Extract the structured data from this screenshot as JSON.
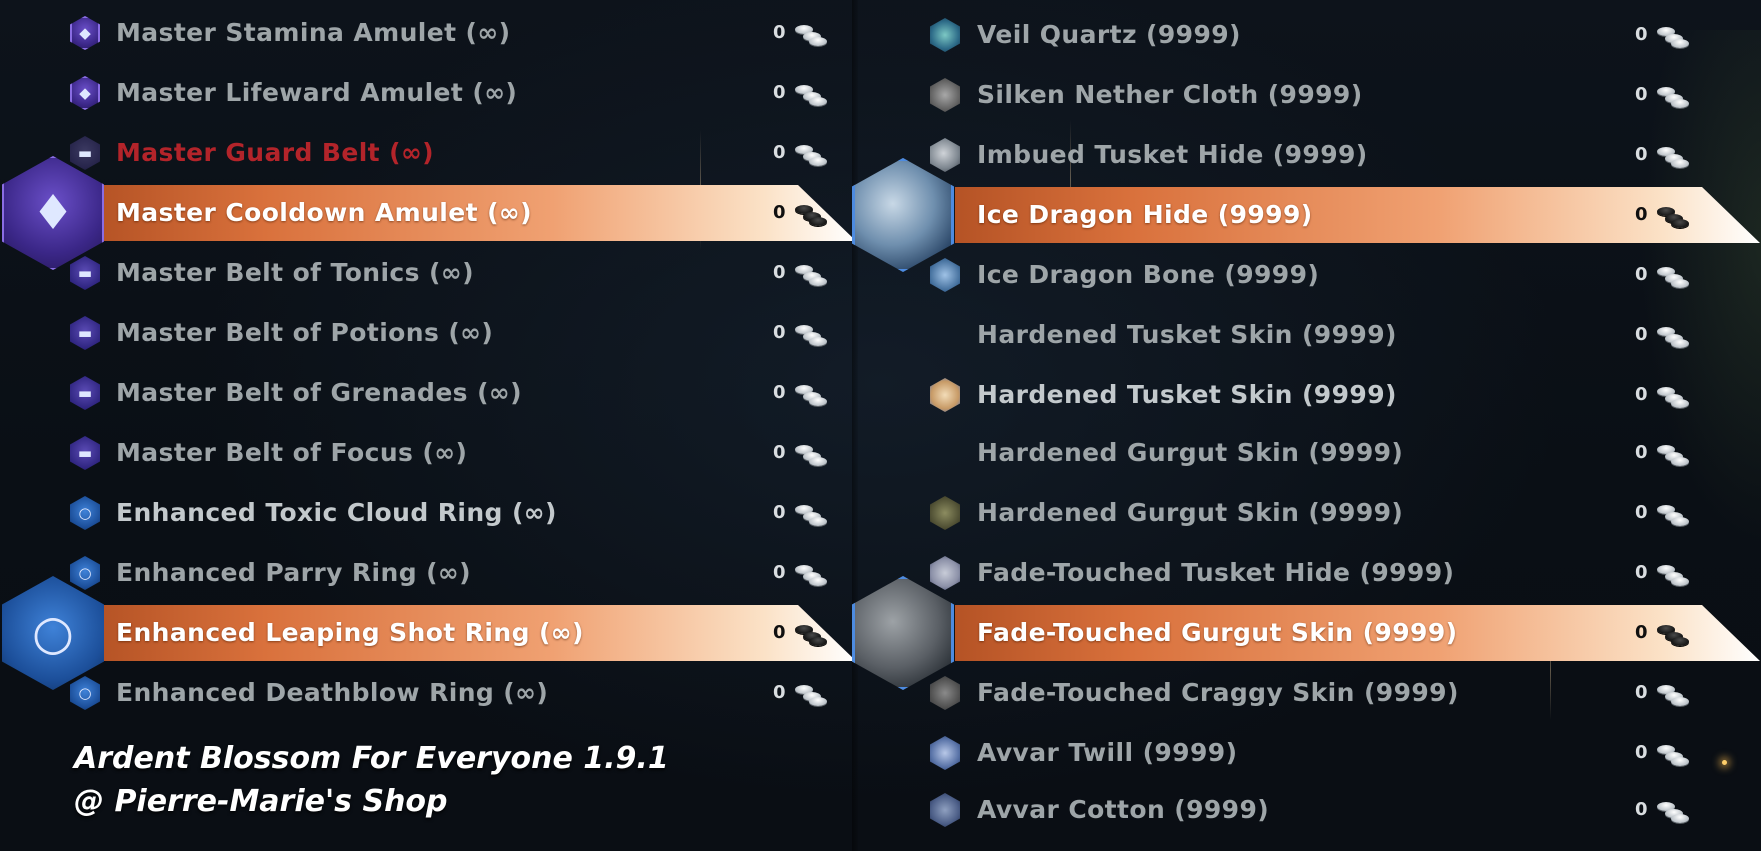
{
  "left_column": {
    "items": [
      {
        "name": "Master Stamina Amulet (∞)",
        "price": "0",
        "icon": "amulet-icon"
      },
      {
        "name": "Master Lifeward Amulet (∞)",
        "price": "0",
        "icon": "amulet-icon"
      },
      {
        "name": "Master Guard Belt (∞)",
        "price": "0",
        "icon": "belt-icon",
        "status": "unavailable"
      },
      {
        "name": "Master Cooldown Amulet (∞)",
        "price": "0",
        "icon": "amulet-icon",
        "selected": true
      },
      {
        "name": "Master Belt of Tonics (∞)",
        "price": "0",
        "icon": "belt-icon"
      },
      {
        "name": "Master Belt of Potions (∞)",
        "price": "0",
        "icon": "belt-icon"
      },
      {
        "name": "Master Belt of Grenades (∞)",
        "price": "0",
        "icon": "belt-icon"
      },
      {
        "name": "Master Belt of Focus (∞)",
        "price": "0",
        "icon": "belt-icon"
      },
      {
        "name": "Enhanced Toxic Cloud Ring (∞)",
        "price": "0",
        "icon": "ring-icon"
      },
      {
        "name": "Enhanced Parry Ring (∞)",
        "price": "0",
        "icon": "ring-icon"
      },
      {
        "name": "Enhanced Leaping Shot Ring (∞)",
        "price": "0",
        "icon": "ring-icon",
        "selected": true
      },
      {
        "name": "Enhanced Deathblow Ring (∞)",
        "price": "0",
        "icon": "ring-icon"
      }
    ]
  },
  "right_column": {
    "items": [
      {
        "name": "Veil Quartz (9999)",
        "price": "0",
        "icon": "crystal-icon"
      },
      {
        "name": "Silken Nether Cloth (9999)",
        "price": "0",
        "icon": "cloth-icon"
      },
      {
        "name": "Imbued Tusket Hide (9999)",
        "price": "0",
        "icon": "hide-icon"
      },
      {
        "name": "Ice Dragon Hide (9999)",
        "price": "0",
        "icon": "hide-icon",
        "selected": true
      },
      {
        "name": "Ice Dragon Bone (9999)",
        "price": "0",
        "icon": "bone-icon"
      },
      {
        "name": "Hardened Tusket Skin (9999)",
        "price": "0",
        "icon": ""
      },
      {
        "name": "Hardened Tusket Skin (9999)",
        "price": "0",
        "icon": "skin-icon"
      },
      {
        "name": "Hardened Gurgut Skin (9999)",
        "price": "0",
        "icon": ""
      },
      {
        "name": "Hardened Gurgut Skin (9999)",
        "price": "0",
        "icon": "skin-icon"
      },
      {
        "name": "Fade-Touched Tusket Hide (9999)",
        "price": "0",
        "icon": "hide-icon"
      },
      {
        "name": "Fade-Touched Gurgut Skin (9999)",
        "price": "0",
        "icon": "skin-icon",
        "selected": true
      },
      {
        "name": "Fade-Touched Craggy Skin (9999)",
        "price": "0",
        "icon": "skin-icon"
      },
      {
        "name": "Avvar Twill (9999)",
        "price": "0",
        "icon": "fabric-icon"
      },
      {
        "name": "Avvar Cotton (9999)",
        "price": "0",
        "icon": "fabric-icon"
      }
    ]
  },
  "watermark": {
    "line1": "Ardent Blossom For Everyone 1.9.1",
    "line2": "@ Pierre-Marie's Shop"
  },
  "colors": {
    "selected_bar": "#f0a172",
    "unavailable_text": "#b3242a",
    "default_text": "#9ea5a8",
    "background": "#0b1017"
  },
  "currency_icon": "coins-icon"
}
